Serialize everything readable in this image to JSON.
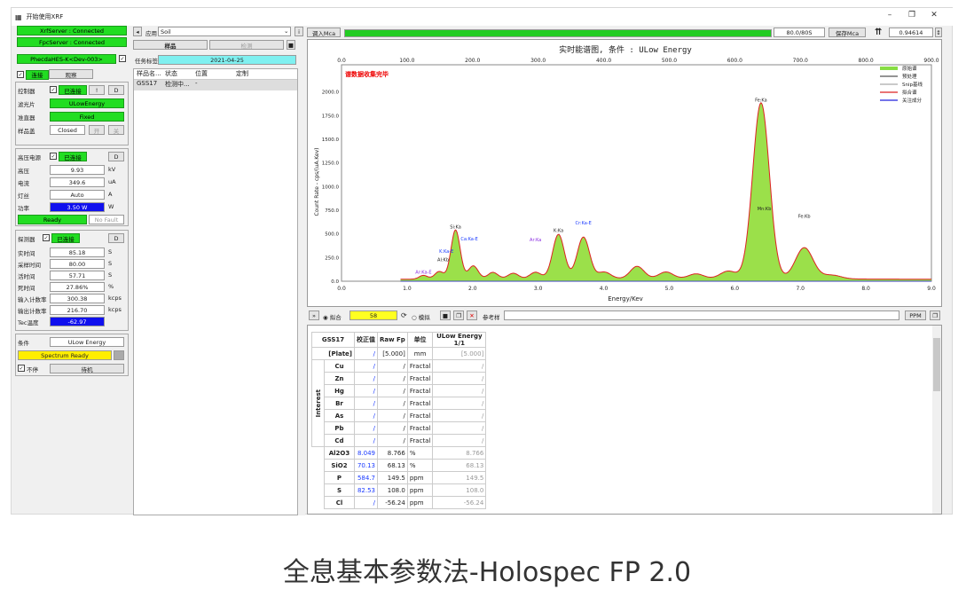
{
  "app": {
    "title": "开始使用XRF"
  },
  "status": {
    "xrf": "XrfServer : Connected",
    "fpc": "FpcServer : Connected",
    "device": "PhecdaHES-K<Dev-003>"
  },
  "tabs": {
    "connect": "连接",
    "observe": "观察"
  },
  "control": {
    "label": "控制器",
    "state": "已连接",
    "btn1": "!",
    "btn2": "D",
    "filter_label": "滤光片",
    "filter": "ULowEnergy",
    "collimator_label": "准直器",
    "collimator": "Fixed",
    "sample_label": "样品盖",
    "sample": "Closed",
    "open": "开",
    "close": "关"
  },
  "hv": {
    "label": "高压电源",
    "state": "已连接",
    "btn": "D",
    "voltage_label": "高压",
    "voltage": "9.93",
    "voltage_unit": "kV",
    "current_label": "电流",
    "current": "349.6",
    "current_unit": "uA",
    "filament_label": "灯丝",
    "filament": "Auto",
    "filament_unit": "A",
    "power_label": "功率",
    "power": "3.50 W",
    "power_unit": "W",
    "ready": "Ready",
    "fault": "No Fault"
  },
  "detector": {
    "label": "探测器",
    "state": "已连接",
    "btn": "D",
    "rows": [
      {
        "label": "实时间",
        "value": "85.18",
        "unit": "S"
      },
      {
        "label": "采样时间",
        "value": "80.00",
        "unit": "S"
      },
      {
        "label": "活时间",
        "value": "57.71",
        "unit": "S"
      },
      {
        "label": "死时间",
        "value": "27.86%",
        "unit": "%"
      },
      {
        "label": "输入计数率",
        "value": "300.38",
        "unit": "kcps"
      },
      {
        "label": "输出计数率",
        "value": "216.70",
        "unit": "kcps"
      },
      {
        "label": "Tec温度",
        "value": "-62.97",
        "unit": ""
      }
    ]
  },
  "condition": {
    "label": "条件",
    "value": "ULow Energy",
    "spectrum": "Spectrum Ready",
    "nonstop": "不停",
    "standby": "待机"
  },
  "middle": {
    "app_label": "应用",
    "app_value": "Soil",
    "sample_btn": "样品",
    "detect_btn": "检测",
    "task_label": "任务标签",
    "task_date": "2021-04-25",
    "headers": [
      "样品名...",
      "状态",
      "位置",
      "定制"
    ],
    "row": [
      "GSS17",
      "检测中...",
      "-",
      ""
    ]
  },
  "top": {
    "load": "调入Mca",
    "progress_text": "80.0/80S",
    "save": "保存Mca",
    "value": "0.94614"
  },
  "chart_data": {
    "type": "line",
    "title": "实时能谱图, 条件 : ULow Energy",
    "status_text": "谱数据收集完毕",
    "xlabel": "Energy/Kev",
    "ylabel": "Count Rate - cps/(uA.Kev)",
    "xlim": [
      0,
      9
    ],
    "ylim": [
      0,
      2100
    ],
    "x_ticks_bottom": [
      "0.0",
      "1.0",
      "2.0",
      "3.0",
      "4.0",
      "5.0",
      "6.0",
      "7.0",
      "8.0",
      "9.0"
    ],
    "x_ticks_top": [
      "0.0",
      "100.0",
      "200.0",
      "300.0",
      "400.0",
      "500.0",
      "600.0",
      "700.0",
      "800.0",
      "900.0"
    ],
    "y_ticks": [
      "0.0",
      "250.0",
      "500.0",
      "750.0",
      "1000.0",
      "1250.0",
      "1500.0",
      "1750.0",
      "2000.0"
    ],
    "legend": [
      "原始谱",
      "预处理",
      "Snip基线",
      "拟合谱",
      "关注成分"
    ],
    "legend_colors": [
      "#88dd44",
      "#555555",
      "#aaaaaa",
      "#dd2222",
      "#2222dd"
    ],
    "peaks": [
      {
        "x": 1.25,
        "y": 40
      },
      {
        "x": 1.49,
        "y": 80
      },
      {
        "x": 1.74,
        "y": 520
      },
      {
        "x": 2.01,
        "y": 140
      },
      {
        "x": 2.31,
        "y": 70
      },
      {
        "x": 2.62,
        "y": 60
      },
      {
        "x": 2.96,
        "y": 70
      },
      {
        "x": 3.31,
        "y": 470
      },
      {
        "x": 3.69,
        "y": 440
      },
      {
        "x": 4.01,
        "y": 70
      },
      {
        "x": 4.51,
        "y": 130
      },
      {
        "x": 4.95,
        "y": 70
      },
      {
        "x": 5.41,
        "y": 50
      },
      {
        "x": 5.9,
        "y": 80
      },
      {
        "x": 6.4,
        "y": 1860
      },
      {
        "x": 7.06,
        "y": 330
      },
      {
        "x": 7.48,
        "y": 40
      }
    ],
    "labels": [
      {
        "t": "Si:Ka",
        "x": 1.74,
        "y": 560,
        "c": "#222"
      },
      {
        "t": "Ca:Ka-E",
        "x": 1.95,
        "y": 430,
        "c": "#1a3aff"
      },
      {
        "t": "K:Ka-E",
        "x": 1.6,
        "y": 300,
        "c": "#1a3aff"
      },
      {
        "t": "Al:Kb",
        "x": 1.55,
        "y": 210,
        "c": "#222"
      },
      {
        "t": "Ar:Ka-E",
        "x": 1.25,
        "y": 80,
        "c": "#8a2be2"
      },
      {
        "t": "Fe:Ka",
        "x": 6.4,
        "y": 1900,
        "c": "#222"
      },
      {
        "t": "Mn:Kb",
        "x": 6.45,
        "y": 750,
        "c": "#222"
      },
      {
        "t": "Cr:Ka-E",
        "x": 3.69,
        "y": 600,
        "c": "#1a3aff"
      },
      {
        "t": "K:Ka",
        "x": 3.31,
        "y": 520,
        "c": "#222"
      },
      {
        "t": "Ar:Ka",
        "x": 2.96,
        "y": 420,
        "c": "#8a2be2"
      },
      {
        "t": "Fe:Kb",
        "x": 7.06,
        "y": 670,
        "c": "#222"
      }
    ]
  },
  "bottom": {
    "mode1": "拟合",
    "count": "58",
    "mode2": "模拟",
    "ref": "参考样",
    "ppm": "PPM"
  },
  "table": {
    "headers": [
      "GSS17",
      "校正值",
      "Raw Fp",
      "单位",
      "ULow Energy 1/1"
    ],
    "plate": [
      "[Plate]",
      "/",
      "[5.000]",
      "mm",
      "[5.000]"
    ],
    "group": "Interest",
    "interest": [
      [
        "Cu",
        "/",
        "/",
        "Fractal",
        "/"
      ],
      [
        "Zn",
        "/",
        "/",
        "Fractal",
        "/"
      ],
      [
        "Hg",
        "/",
        "/",
        "Fractal",
        "/"
      ],
      [
        "Br",
        "/",
        "/",
        "Fractal",
        "/"
      ],
      [
        "As",
        "/",
        "/",
        "Fractal",
        "/"
      ],
      [
        "Pb",
        "/",
        "/",
        "Fractal",
        "/"
      ],
      [
        "Cd",
        "/",
        "/",
        "Fractal",
        "/"
      ]
    ],
    "rows": [
      [
        "Al2O3",
        "8.049",
        "8.766",
        "%",
        "8.766"
      ],
      [
        "SiO2",
        "70.13",
        "68.13",
        "%",
        "68.13"
      ],
      [
        "P",
        "584.7",
        "149.5",
        "ppm",
        "149.5"
      ],
      [
        "S",
        "82.53",
        "108.0",
        "ppm",
        "108.0"
      ],
      [
        "Cl",
        "/",
        "-56.24",
        "ppm",
        "-56.24"
      ]
    ]
  },
  "caption": "全息基本参数法-Holospec FP 2.0"
}
